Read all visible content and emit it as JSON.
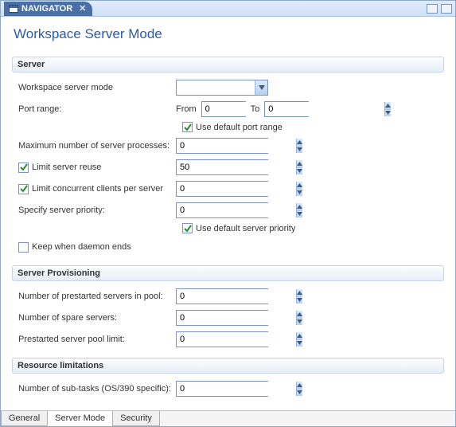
{
  "titlebar": {
    "tab_label": "NAVIGATOR"
  },
  "page_title": "Workspace Server Mode",
  "sections": {
    "server": {
      "header": "Server",
      "workspace_mode_label": "Workspace server mode",
      "workspace_mode_value": "",
      "port_range_label": "Port range:",
      "port_from_label": "From",
      "port_from_value": "0",
      "port_to_label": "To",
      "port_to_value": "0",
      "use_default_port_label": "Use default port range",
      "use_default_port_checked": true,
      "max_procs_label": "Maximum number of server processes:",
      "max_procs_value": "0",
      "limit_reuse_label": "Limit server reuse",
      "limit_reuse_checked": true,
      "limit_reuse_value": "50",
      "limit_concurrent_label": "Limit concurrent clients per server",
      "limit_concurrent_checked": true,
      "limit_concurrent_value": "0",
      "server_priority_label": "Specify server priority:",
      "server_priority_value": "0",
      "use_default_priority_label": "Use  default server priority",
      "use_default_priority_checked": true,
      "keep_daemon_label": "Keep when daemon ends",
      "keep_daemon_checked": false
    },
    "provisioning": {
      "header": "Server Provisioning",
      "prestarted_pool_label": "Number of prestarted servers in pool:",
      "prestarted_pool_value": "0",
      "spare_servers_label": "Number of spare servers:",
      "spare_servers_value": "0",
      "pool_limit_label": "Prestarted server pool limit:",
      "pool_limit_value": "0"
    },
    "resource": {
      "header": "Resource limitations",
      "subtasks_label": "Number of sub-tasks (OS/390 specific):",
      "subtasks_value": "0"
    }
  },
  "bottom_tabs": {
    "general": "General",
    "server_mode": "Server Mode",
    "security": "Security"
  }
}
